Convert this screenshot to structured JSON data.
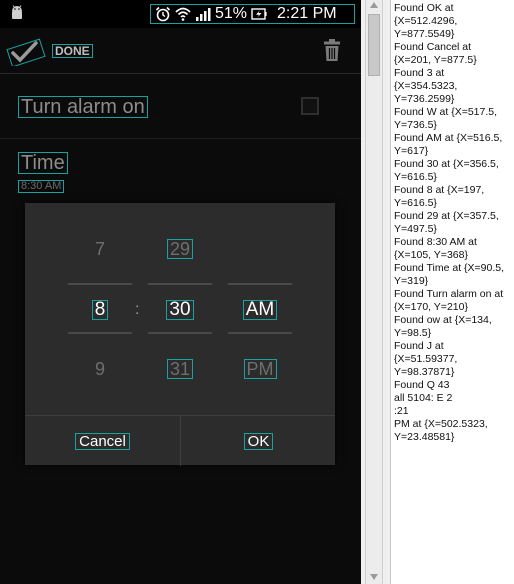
{
  "statusbar": {
    "battery": "51%",
    "time": "2:21 PM",
    "icons": [
      "android-icon",
      "alarm-clock-icon",
      "wifi-icon",
      "signal-icon",
      "battery-charging-icon"
    ]
  },
  "actionbar": {
    "done_label": "DONE",
    "trash_icon": "trash-icon"
  },
  "settings": {
    "alarm_label": "Turn alarm on",
    "time_label": "Time",
    "time_value": "8:30 AM"
  },
  "picker": {
    "hour": {
      "prev": "7",
      "current": "8",
      "next": "9"
    },
    "minute": {
      "prev": "29",
      "current": "30",
      "next": "31"
    },
    "ampm": {
      "current": "AM",
      "next": "PM"
    },
    "separator": ":"
  },
  "dialog": {
    "cancel_label": "Cancel",
    "ok_label": "OK"
  },
  "log": {
    "lines": [
      "Found OK at",
      "{X=512.4296,",
      "Y=877.5549}",
      "Found Cancel at",
      "{X=201, Y=877.5}",
      "Found 3 at",
      "{X=354.5323,",
      "Y=736.2599}",
      "Found W at {X=517.5,",
      "Y=736.5}",
      "Found AM at {X=516.5,",
      "Y=617}",
      "Found 30 at {X=356.5,",
      "Y=616.5}",
      "Found 8 at {X=197,",
      "Y=616.5}",
      "Found 29 at {X=357.5,",
      "Y=497.5}",
      "Found 8:30 AM at",
      "{X=105, Y=368}",
      "Found Time at {X=90.5,",
      "Y=319}",
      "Found Turn alarm on at",
      "{X=170, Y=210}",
      "Found ow at {X=134,",
      "Y=98.5}",
      "Found J at",
      "{X=51.59377,",
      "Y=98.37871}",
      "Found Q 43",
      "all 5104: E 2",
      ":21",
      "PM at {X=502.5323,",
      "Y=23.48581}"
    ]
  },
  "colors": {
    "phone_bg": "#0b0b0b",
    "dialog_bg": "#2c2c2c",
    "highlight": "#19a0a0",
    "text_dim": "#8c8c8c"
  }
}
